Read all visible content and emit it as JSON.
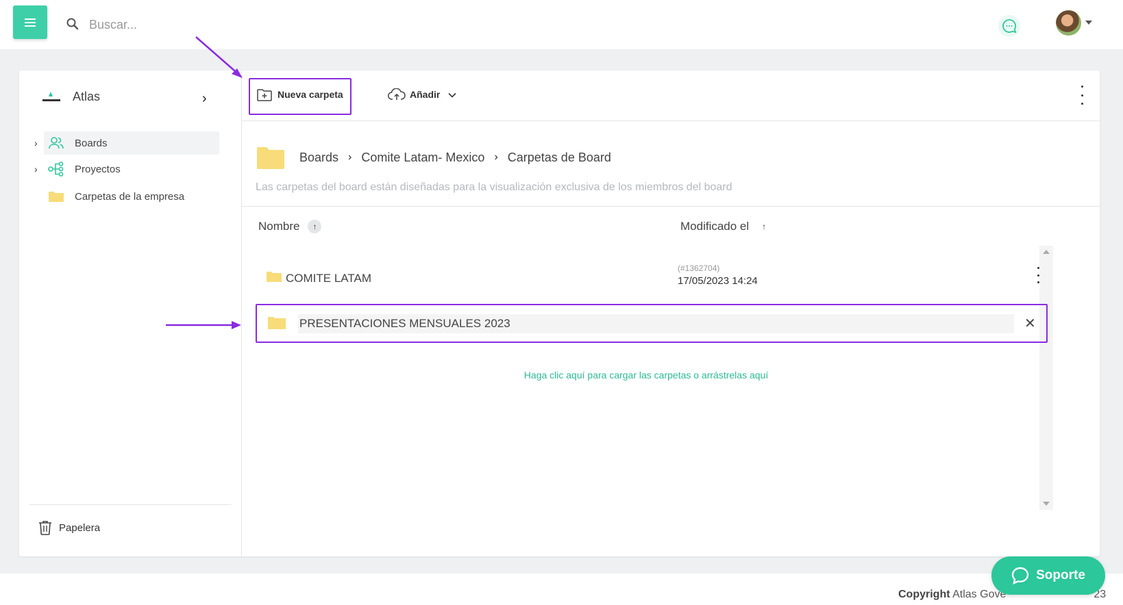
{
  "topbar": {
    "search_placeholder": "Buscar..."
  },
  "sidebar": {
    "brand": "Atlas",
    "items": [
      {
        "label": "Boards",
        "icon": "users-icon",
        "expandable": true,
        "active": true
      },
      {
        "label": "Proyectos",
        "icon": "hierarchy-icon",
        "expandable": true,
        "active": false
      },
      {
        "label": "Carpetas de la empresa",
        "icon": "folder-icon",
        "expandable": false,
        "active": false
      }
    ],
    "trash_label": "Papelera"
  },
  "toolbar": {
    "new_folder_label": "Nueva carpeta",
    "add_label": "Añadir"
  },
  "breadcrumb": [
    "Boards",
    "Comite Latam- Mexico",
    "Carpetas de Board"
  ],
  "description": "Las carpetas del board están diseñadas para la visualización exclusiva de los miembros del board",
  "columns": {
    "name": "Nombre",
    "modified": "Modificado el"
  },
  "rows": [
    {
      "name": "COMITE LATAM",
      "id": "(#1362704)",
      "modified": "17/05/2023 14:24"
    }
  ],
  "new_folder_input_value": "PRESENTACIONES MENSUALES 2023",
  "upload_hint": "Haga clic aquí para cargar las carpetas o arrástrelas aquí",
  "footer": {
    "copyright_label": "Copyright",
    "copyright_text": "Atlas Gove",
    "copyright_tail": "23"
  },
  "support_label": "Soporte",
  "colors": {
    "accent": "#3ecfa9",
    "highlight": "#8a2be2",
    "folder": "#f7dc79",
    "link": "#2cba93"
  }
}
